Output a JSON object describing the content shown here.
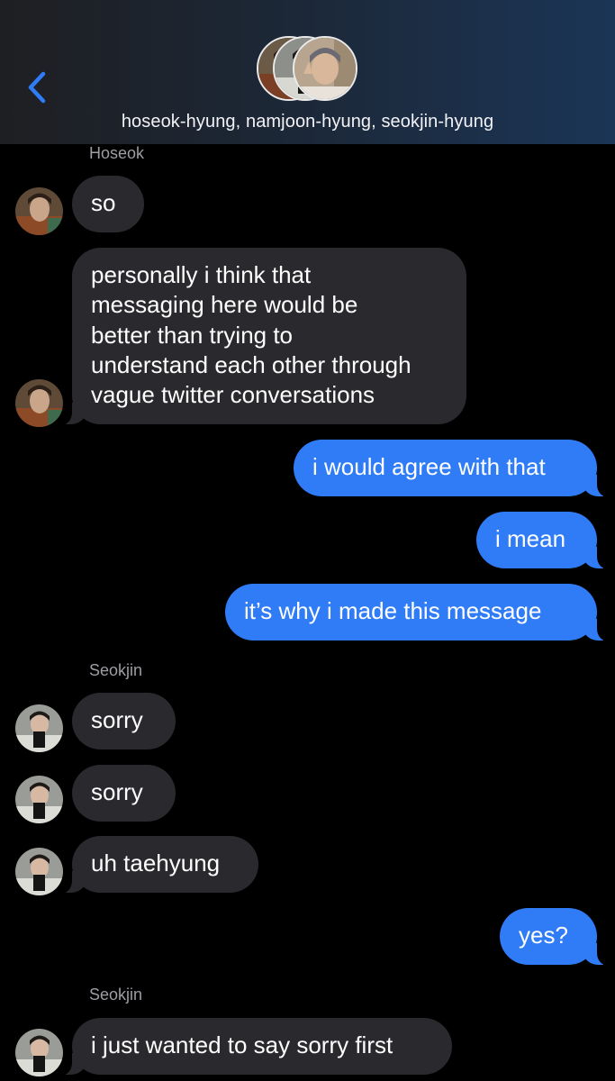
{
  "header": {
    "group_title": "hoseok-hyung, namjoon-hyung, seokjin-hyung",
    "avatar_icons": [
      "hoseok-avatar",
      "seokjin-avatar",
      "namjoon-avatar"
    ],
    "back_icon": "chevron-left-icon"
  },
  "colors": {
    "background": "#000000",
    "received_bubble": "#2a2a2e",
    "sent_bubble": "#2f7cf6",
    "accent": "#2f7cf6",
    "sender_label": "#9d9da3"
  },
  "messages": [
    {
      "sender": "Hoseok",
      "text": "so",
      "direction": "received"
    },
    {
      "text": "personally i think that\nmessaging here would be\nbetter than trying to\nunderstand each other through\nvague twitter conversations",
      "direction": "received"
    },
    {
      "text": "i would agree with that",
      "direction": "sent"
    },
    {
      "text": "i mean",
      "direction": "sent"
    },
    {
      "text": "it’s why i made this message",
      "direction": "sent"
    },
    {
      "sender": "Seokjin",
      "text": "sorry",
      "direction": "received"
    },
    {
      "text": "sorry",
      "direction": "received"
    },
    {
      "text": "uh taehyung",
      "direction": "received"
    },
    {
      "text": "yes?",
      "direction": "sent"
    },
    {
      "sender": "Seokjin",
      "text": "i just wanted to say sorry first",
      "direction": "received"
    }
  ],
  "message_lines": {
    "m1": [
      "personally i think that",
      "messaging here would be",
      "better than trying to",
      "understand each other through",
      "vague twitter conversations"
    ]
  }
}
